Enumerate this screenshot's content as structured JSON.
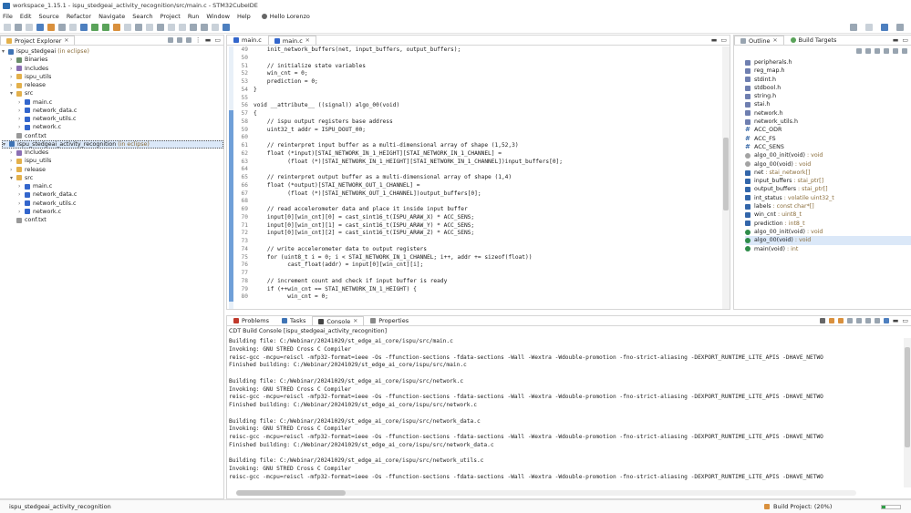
{
  "window": {
    "title": "workspace_1.15.1 - ispu_stedgeai_activity_recognition/src/main.c - STM32CubeIDE"
  },
  "menu": {
    "items": [
      "File",
      "Edit",
      "Source",
      "Refactor",
      "Navigate",
      "Search",
      "Project",
      "Run",
      "Window",
      "Help"
    ],
    "user": "Hello Lorenzo"
  },
  "project_explorer": {
    "tab": "Project Explorer",
    "rows": [
      {
        "indent": 0,
        "arrow": "v",
        "icon": "proj",
        "label": "ispu_stedgeai",
        "extra": "(in eclipse)"
      },
      {
        "indent": 1,
        "arrow": ">",
        "icon": "bin",
        "label": "Binaries",
        "extra": ""
      },
      {
        "indent": 1,
        "arrow": ">",
        "icon": "inc",
        "label": "Includes",
        "extra": ""
      },
      {
        "indent": 1,
        "arrow": ">",
        "icon": "fold",
        "label": "ispu_utils",
        "extra": ""
      },
      {
        "indent": 1,
        "arrow": ">",
        "icon": "fold",
        "label": "release",
        "extra": ""
      },
      {
        "indent": 1,
        "arrow": "v",
        "icon": "fold",
        "label": "src",
        "extra": ""
      },
      {
        "indent": 2,
        "arrow": ">",
        "icon": "c",
        "label": "main.c",
        "extra": ""
      },
      {
        "indent": 2,
        "arrow": ">",
        "icon": "c",
        "label": "network_data.c",
        "extra": ""
      },
      {
        "indent": 2,
        "arrow": ">",
        "icon": "c",
        "label": "network_utils.c",
        "extra": ""
      },
      {
        "indent": 2,
        "arrow": ">",
        "icon": "c",
        "label": "network.c",
        "extra": ""
      },
      {
        "indent": 1,
        "arrow": "",
        "icon": "txt",
        "label": "conf.txt",
        "extra": ""
      },
      {
        "indent": 0,
        "arrow": "v",
        "icon": "proj",
        "label": "ispu_stedgeai_activity_recognition",
        "extra": "(in eclipse)",
        "selected": true
      },
      {
        "indent": 1,
        "arrow": ">",
        "icon": "inc",
        "label": "Includes",
        "extra": ""
      },
      {
        "indent": 1,
        "arrow": ">",
        "icon": "fold",
        "label": "ispu_utils",
        "extra": ""
      },
      {
        "indent": 1,
        "arrow": ">",
        "icon": "fold",
        "label": "release",
        "extra": ""
      },
      {
        "indent": 1,
        "arrow": "v",
        "icon": "fold",
        "label": "src",
        "extra": ""
      },
      {
        "indent": 2,
        "arrow": ">",
        "icon": "c",
        "label": "main.c",
        "extra": ""
      },
      {
        "indent": 2,
        "arrow": ">",
        "icon": "c",
        "label": "network_data.c",
        "extra": ""
      },
      {
        "indent": 2,
        "arrow": ">",
        "icon": "c",
        "label": "network_utils.c",
        "extra": ""
      },
      {
        "indent": 2,
        "arrow": ">",
        "icon": "c",
        "label": "network.c",
        "extra": ""
      },
      {
        "indent": 1,
        "arrow": "",
        "icon": "txt",
        "label": "conf.txt",
        "extra": ""
      }
    ]
  },
  "editor": {
    "tabs": [
      "main.c",
      "main.c"
    ],
    "lines": [
      {
        "n": "49",
        "t": "    init_network_buffers(net, input_buffers, output_buffers);"
      },
      {
        "n": "50",
        "t": ""
      },
      {
        "n": "51",
        "t": "    // initialize state variables"
      },
      {
        "n": "52",
        "t": "    win_cnt = 0;"
      },
      {
        "n": "53",
        "t": "    prediction = 0;"
      },
      {
        "n": "54",
        "t": "}"
      },
      {
        "n": "55",
        "t": ""
      },
      {
        "n": "56",
        "t": "void __attribute__ ((signal)) algo_00(void)"
      },
      {
        "n": "57",
        "t": "{"
      },
      {
        "n": "58",
        "t": "    // ispu output registers base address"
      },
      {
        "n": "59",
        "t": "    uint32_t addr = ISPU_DOUT_00;"
      },
      {
        "n": "60",
        "t": ""
      },
      {
        "n": "61",
        "t": "    // reinterpret input buffer as a multi-dimensional array of shape (1,52,3)"
      },
      {
        "n": "62",
        "t": "    float (*input)[STAI_NETWORK_IN_1_HEIGHT][STAI_NETWORK_IN_1_CHANNEL] ="
      },
      {
        "n": "63",
        "t": "          (float (*)[STAI_NETWORK_IN_1_HEIGHT][STAI_NETWORK_IN_1_CHANNEL])input_buffers[0];"
      },
      {
        "n": "64",
        "t": ""
      },
      {
        "n": "65",
        "t": "    // reinterpret output buffer as a multi-dimensional array of shape (1,4)"
      },
      {
        "n": "66",
        "t": "    float (*output)[STAI_NETWORK_OUT_1_CHANNEL] ="
      },
      {
        "n": "67",
        "t": "          (float (*)[STAI_NETWORK_OUT_1_CHANNEL])output_buffers[0];"
      },
      {
        "n": "68",
        "t": ""
      },
      {
        "n": "69",
        "t": "    // read accelerometer data and place it inside input buffer"
      },
      {
        "n": "70",
        "t": "    input[0][win_cnt][0] = cast_sint16_t(ISPU_ARAW_X) * ACC_SENS;"
      },
      {
        "n": "71",
        "t": "    input[0][win_cnt][1] = cast_sint16_t(ISPU_ARAW_Y) * ACC_SENS;"
      },
      {
        "n": "72",
        "t": "    input[0][win_cnt][2] = cast_sint16_t(ISPU_ARAW_Z) * ACC_SENS;"
      },
      {
        "n": "73",
        "t": ""
      },
      {
        "n": "74",
        "t": "    // write accelerometer data to output registers"
      },
      {
        "n": "75",
        "t": "    for (uint8_t i = 0; i < STAI_NETWORK_IN_1_CHANNEL; i++, addr += sizeof(float))"
      },
      {
        "n": "76",
        "t": "          cast_float(addr) = input[0][win_cnt][i];"
      },
      {
        "n": "77",
        "t": ""
      },
      {
        "n": "78",
        "t": "    // increment count and check if input buffer is ready"
      },
      {
        "n": "79",
        "t": "    if (++win_cnt == STAI_NETWORK_IN_1_HEIGHT) {"
      },
      {
        "n": "80",
        "t": "          win_cnt = 0;"
      }
    ]
  },
  "outline": {
    "tabs": [
      "Outline",
      "Build Targets"
    ],
    "rows": [
      {
        "icon": "inc",
        "label": "peripherals.h",
        "type": ""
      },
      {
        "icon": "inc",
        "label": "reg_map.h",
        "type": ""
      },
      {
        "icon": "inc",
        "label": "stdint.h",
        "type": ""
      },
      {
        "icon": "inc",
        "label": "stdbool.h",
        "type": ""
      },
      {
        "icon": "inc",
        "label": "string.h",
        "type": ""
      },
      {
        "icon": "inc",
        "label": "stai.h",
        "type": ""
      },
      {
        "icon": "inc",
        "label": "network.h",
        "type": ""
      },
      {
        "icon": "inc",
        "label": "network_utils.h",
        "type": ""
      },
      {
        "icon": "def",
        "label": "ACC_ODR",
        "type": ""
      },
      {
        "icon": "def",
        "label": "ACC_FS",
        "type": ""
      },
      {
        "icon": "def",
        "label": "ACC_SENS",
        "type": ""
      },
      {
        "icon": "fnp",
        "label": "algo_00_init(void)",
        "type": ": void"
      },
      {
        "icon": "fnp",
        "label": "algo_00(void)",
        "type": ": void"
      },
      {
        "icon": "var",
        "label": "net",
        "type": ": stai_network[]"
      },
      {
        "icon": "var",
        "label": "input_buffers",
        "type": ": stai_ptr[]"
      },
      {
        "icon": "var",
        "label": "output_buffers",
        "type": ": stai_ptr[]"
      },
      {
        "icon": "var",
        "label": "int_status",
        "type": ": volatile uint32_t"
      },
      {
        "icon": "var",
        "label": "labels",
        "type": ": const char*[]"
      },
      {
        "icon": "var",
        "label": "win_cnt",
        "type": ": uint8_t"
      },
      {
        "icon": "var",
        "label": "prediction",
        "type": ": int8_t"
      },
      {
        "icon": "fn",
        "label": "algo_00_init(void)",
        "type": ": void"
      },
      {
        "icon": "fn",
        "label": "algo_00(void)",
        "type": ": void",
        "selected": true
      },
      {
        "icon": "fn",
        "label": "main(void)",
        "type": ": int"
      }
    ]
  },
  "bottom": {
    "tabs": [
      "Problems",
      "Tasks",
      "Console",
      "Properties"
    ],
    "console_title": "CDT Build Console [ispu_stedgeai_activity_recognition]",
    "lines": [
      "Building file: C:/Webinar/20241029/st_edge_ai_core/ispu/src/main.c",
      "Invoking: GNU STRED Cross C Compiler",
      "reisc-gcc -mcpu=reiscl -mfp32-format=ieee -Os -ffunction-sections -fdata-sections -Wall -Wextra -Wdouble-promotion -fno-strict-aliasing -DEXPORT_RUNTIME_LITE_APIS -DHAVE_NETWO",
      "Finished building: C:/Webinar/20241029/st_edge_ai_core/ispu/src/main.c",
      "",
      "Building file: C:/Webinar/20241029/st_edge_ai_core/ispu/src/network.c",
      "Invoking: GNU STRED Cross C Compiler",
      "reisc-gcc -mcpu=reiscl -mfp32-format=ieee -Os -ffunction-sections -fdata-sections -Wall -Wextra -Wdouble-promotion -fno-strict-aliasing -DEXPORT_RUNTIME_LITE_APIS -DHAVE_NETWO",
      "Finished building: C:/Webinar/20241029/st_edge_ai_core/ispu/src/network.c",
      "",
      "Building file: C:/Webinar/20241029/st_edge_ai_core/ispu/src/network_data.c",
      "Invoking: GNU STRED Cross C Compiler",
      "reisc-gcc -mcpu=reiscl -mfp32-format=ieee -Os -ffunction-sections -fdata-sections -Wall -Wextra -Wdouble-promotion -fno-strict-aliasing -DEXPORT_RUNTIME_LITE_APIS -DHAVE_NETWO",
      "Finished building: C:/Webinar/20241029/st_edge_ai_core/ispu/src/network_data.c",
      "",
      "Building file: C:/Webinar/20241029/st_edge_ai_core/ispu/src/network_utils.c",
      "Invoking: GNU STRED Cross C Compiler",
      "reisc-gcc -mcpu=reiscl -mfp32-format=ieee -Os -ffunction-sections -fdata-sections -Wall -Wextra -Wdouble-promotion -fno-strict-aliasing -DEXPORT_RUNTIME_LITE_APIS -DHAVE_NETWO"
    ]
  },
  "status": {
    "left": "ispu_stedgeai_activity_recognition",
    "build": "Build Project: (20%)",
    "progress": 0.2
  },
  "colors": {
    "accent": "#3f74b5",
    "selection": "#dbe8f8",
    "progress": "#2e9e45"
  }
}
